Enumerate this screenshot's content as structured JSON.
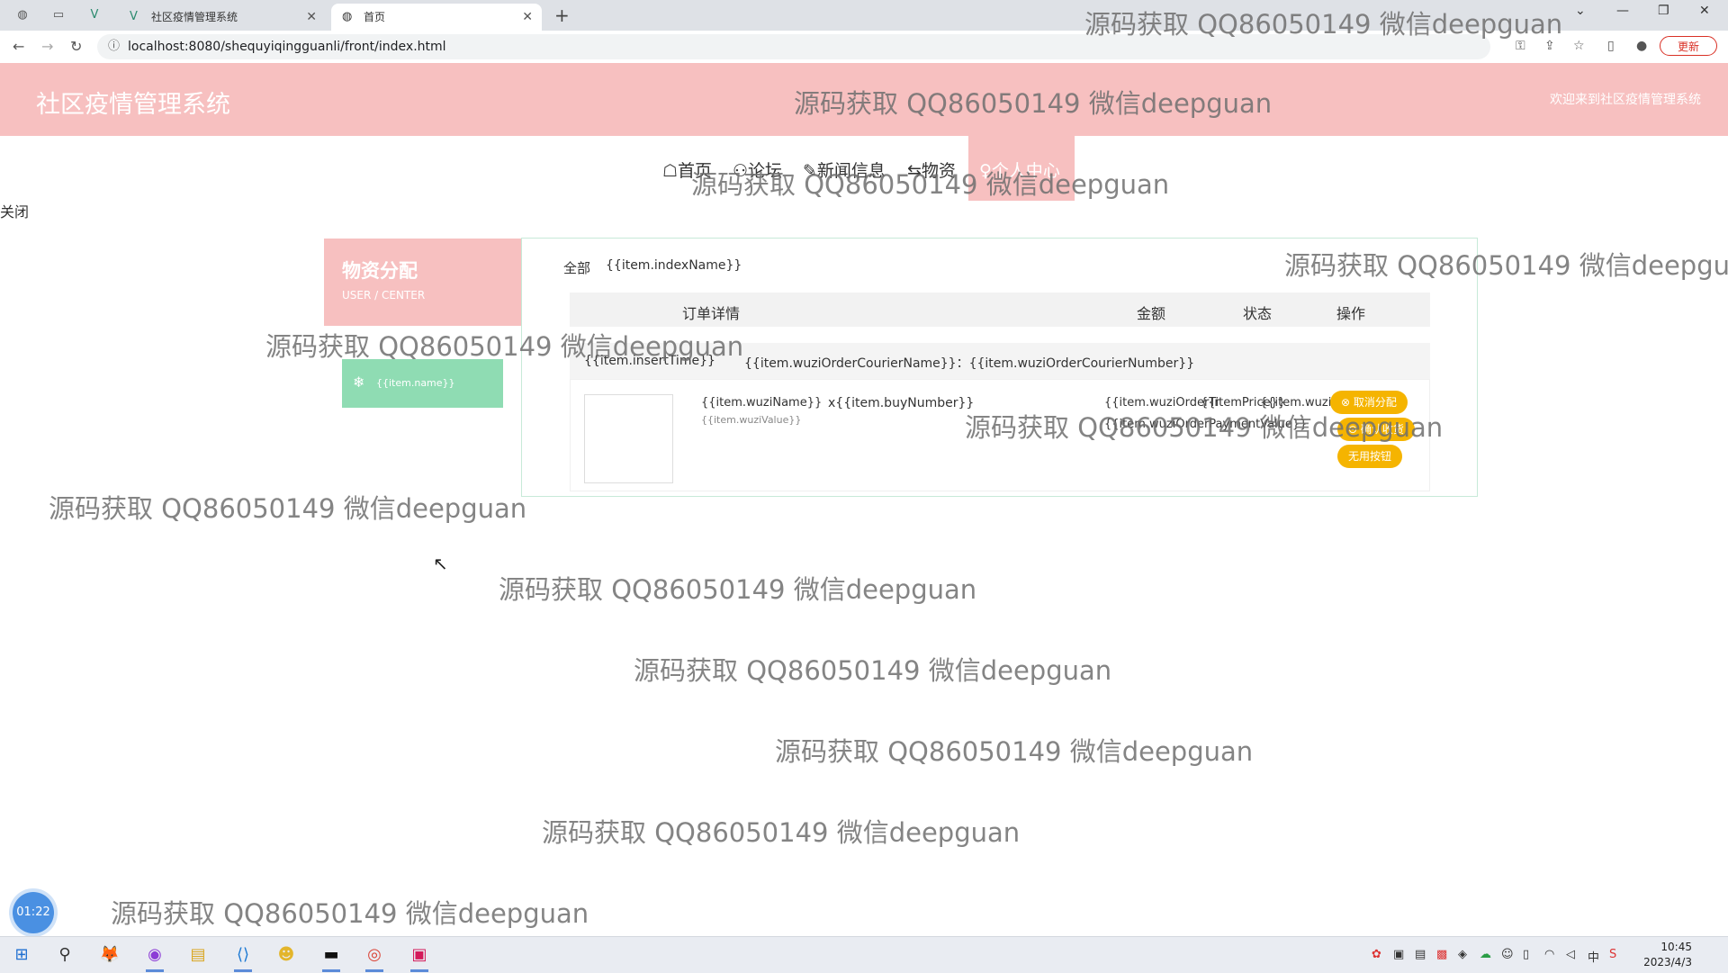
{
  "browser": {
    "tabs": [
      {
        "title": "社区疫情管理系统"
      },
      {
        "title": "首页"
      }
    ],
    "new_tab": "+",
    "url": "localhost:8080/shequyiqingguanli/front/index.html",
    "update_label": "更新",
    "window_controls": [
      "⌄",
      "—",
      "❐",
      "✕"
    ]
  },
  "header": {
    "title": "社区疫情管理系统",
    "welcome": "欢迎来到社区疫情管理系统"
  },
  "nav": {
    "items": [
      {
        "label": "☖首页"
      },
      {
        "label": "⚇论坛"
      },
      {
        "label": "✎新闻信息"
      },
      {
        "label": "⇆物资"
      },
      {
        "label": "♀个人中心"
      }
    ]
  },
  "close_label": "关闭",
  "sidebar": {
    "title": "物资分配",
    "subtitle": "USER / CENTER",
    "item_icon": "❄",
    "item_label": "{{item.name}}"
  },
  "main": {
    "filter_all": "全部",
    "filter_name": "{{item.indexName}}",
    "columns": [
      "订单详情",
      "金额",
      "状态",
      "操作"
    ],
    "order_time": "{{item.insertTime}}",
    "courier": "{{item.wuziOrderCourierName}}：{{item.wuziOrderCourierNumber}}",
    "goods_name": "{{item.wuziName}}",
    "goods_value": "{{item.wuziValue}}",
    "buy_number": "x{{item.buyNumber}}",
    "price_a": "{{item.wuziOrderTr",
    "price_b": "{{item.wuziOrderV",
    "price_c": "{{itemPrice}}",
    "payment": "{{item.wuziOrderPaymentValue}}",
    "actions": [
      "⊗ 取消分配",
      "⊙ 确认收货",
      "无用按钮"
    ]
  },
  "watermark": "源码获取 QQ86050149 微信deepguan",
  "timer": "01:22",
  "taskbar": {
    "apps": [
      "⊞",
      "⚲",
      "🦊",
      "◉",
      "▤",
      "⟨⟩",
      "☻",
      "▬",
      "◎",
      "▣"
    ],
    "tray_ime": "中",
    "time": "10:45",
    "date": "2023/4/3"
  },
  "colors": {
    "brand_pink": "#f7c0c0",
    "accent_green": "#8fdcb3",
    "button_yellow": "#f5b400"
  }
}
